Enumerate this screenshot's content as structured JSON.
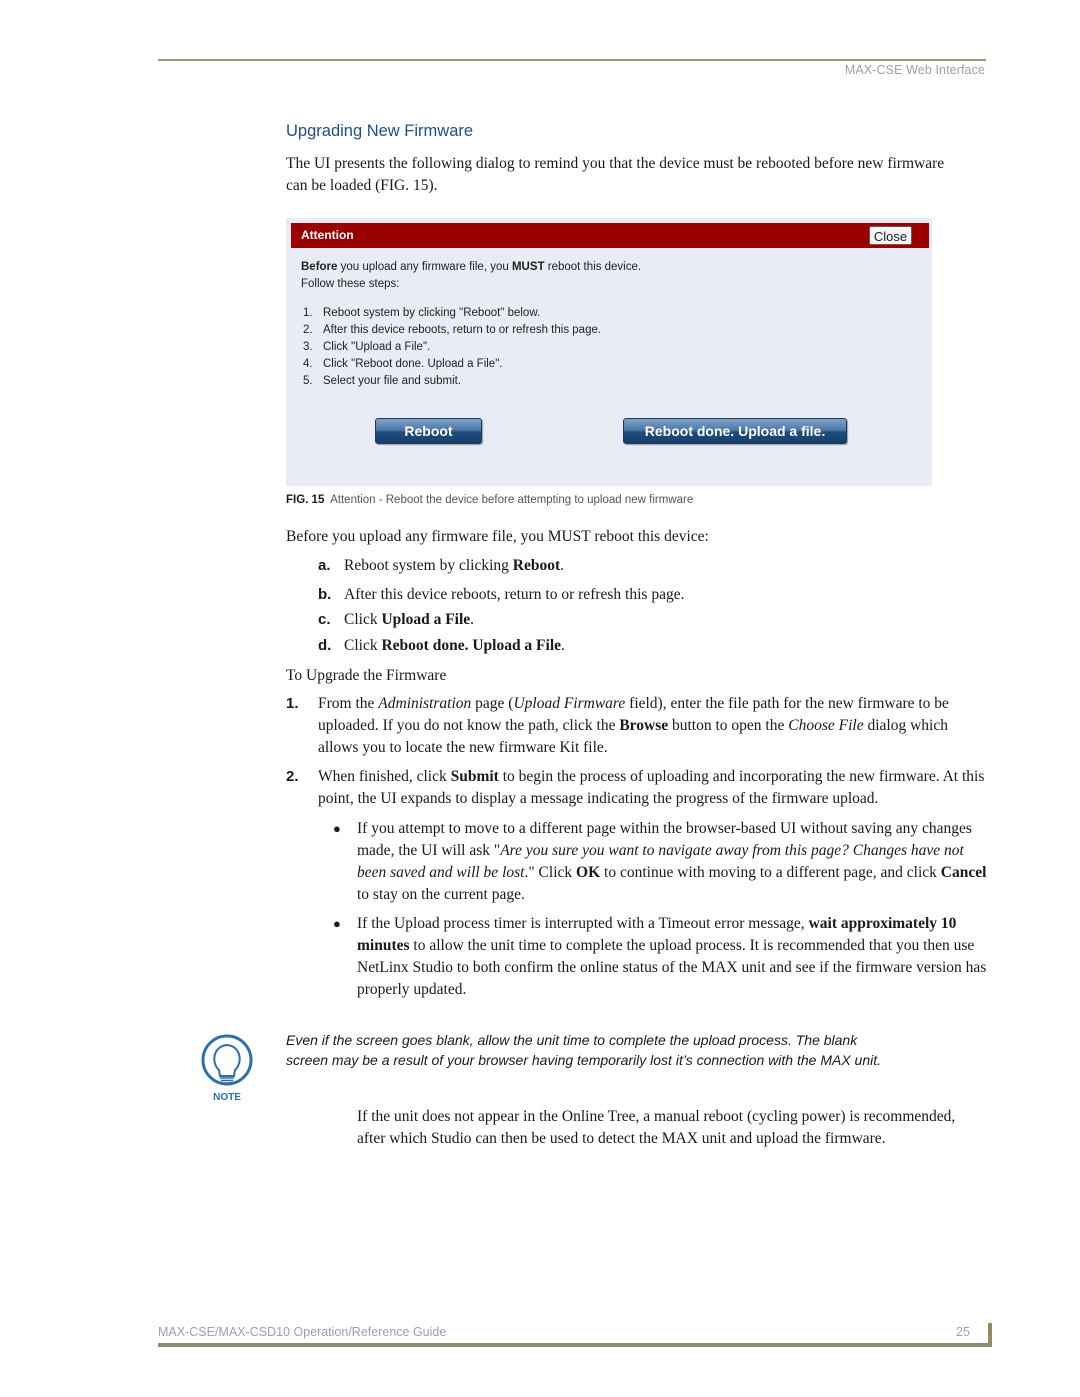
{
  "header": {
    "running_title": "MAX-CSE Web Interface"
  },
  "section": {
    "heading": "Upgrading New Firmware",
    "intro": "The UI presents the following dialog to remind you that the device must be rebooted before new firmware can be loaded (FIG. 15)."
  },
  "dialog": {
    "title": "Attention",
    "close_label": "Close",
    "lead_bold_1": "Before",
    "lead_1": " you upload any firmware file, you ",
    "lead_bold_2": "MUST",
    "lead_2": " reboot this device.",
    "follow": "Follow these steps:",
    "steps": [
      {
        "num": "1.",
        "text": "Reboot system by clicking \"Reboot\" below."
      },
      {
        "num": "2.",
        "text": "After this device reboots, return to or refresh this page."
      },
      {
        "num": "3.",
        "text": "Click \"Upload a File\"."
      },
      {
        "num": "4.",
        "text": "Click \"Reboot done. Upload a File\"."
      },
      {
        "num": "5.",
        "text": "Select your file and submit."
      }
    ],
    "reboot_button": "Reboot",
    "reboot_done_button": "Reboot done. Upload a file."
  },
  "figure": {
    "label": "FIG. 15",
    "caption": "Attention - Reboot the device before attempting to upload new firmware"
  },
  "before": "Before you upload any firmware file, you MUST reboot this device:",
  "letter_items": [
    {
      "label": "a.",
      "pre": "Reboot system by clicking ",
      "bold": "Reboot",
      "post": "."
    },
    {
      "label": "b.",
      "pre": "After this device reboots, return to or refresh this page.",
      "bold": "",
      "post": ""
    },
    {
      "label": "c.",
      "pre": "Click ",
      "bold": "Upload a File",
      "post": "."
    },
    {
      "label": "d.",
      "pre": "Click ",
      "bold": "Reboot done. Upload a File",
      "post": "."
    }
  ],
  "to_upgrade": "To Upgrade the Firmware",
  "steps": {
    "s1": {
      "label": "1.",
      "t1": "From the ",
      "i1": "Administration",
      "t2": " page (",
      "i2": "Upload Firmware",
      "t3": " field), enter the file path for the new firmware to be uploaded. If you do not know the path, click the ",
      "b1": "Browse",
      "t4": " button to open the ",
      "i3": "Choose File",
      "t5": " dialog which allows you to locate the new firmware Kit file."
    },
    "s2": {
      "label": "2.",
      "t1": "When finished, click ",
      "b1": "Submit",
      "t2": " to begin the process of uploading and incorporating the new firmware. At this point, the UI expands to display a message indicating the progress of the firmware upload."
    }
  },
  "bullets": {
    "b1": {
      "t1": "If you attempt to move to a different page within the browser-based UI without saving any changes made, the UI will ask \"",
      "i1": "Are you sure you want to navigate away from this page? Changes have not been saved and will be lost",
      "t2": ".\" Click ",
      "bold1": "OK",
      "t3": " to continue with moving to a different page, and click ",
      "bold2": "Cancel",
      "t4": " to stay on the current page."
    },
    "b2": {
      "t1": "If the Upload process timer is interrupted with a Timeout error message, ",
      "bold1": "wait approximately 10 minutes",
      "t2": " to allow the unit time to complete the upload process. It is recommended that you then use NetLinx Studio to both confirm the online status of the MAX unit and see if the firmware version has properly updated."
    }
  },
  "note": {
    "icon_label": "NOTE",
    "text": "Even if the screen goes blank, allow the unit time to complete the upload process. The blank screen may be a result of your browser having temporarily lost it’s connection with the MAX unit."
  },
  "followup": "If the unit does not appear in the Online Tree, a manual reboot (cycling power) is recommended, after which Studio can then be used to detect the MAX unit and upload the firmware.",
  "footer": {
    "guide_title": "MAX-CSE/MAX-CSD10 Operation/Reference Guide",
    "page_number": "25"
  }
}
